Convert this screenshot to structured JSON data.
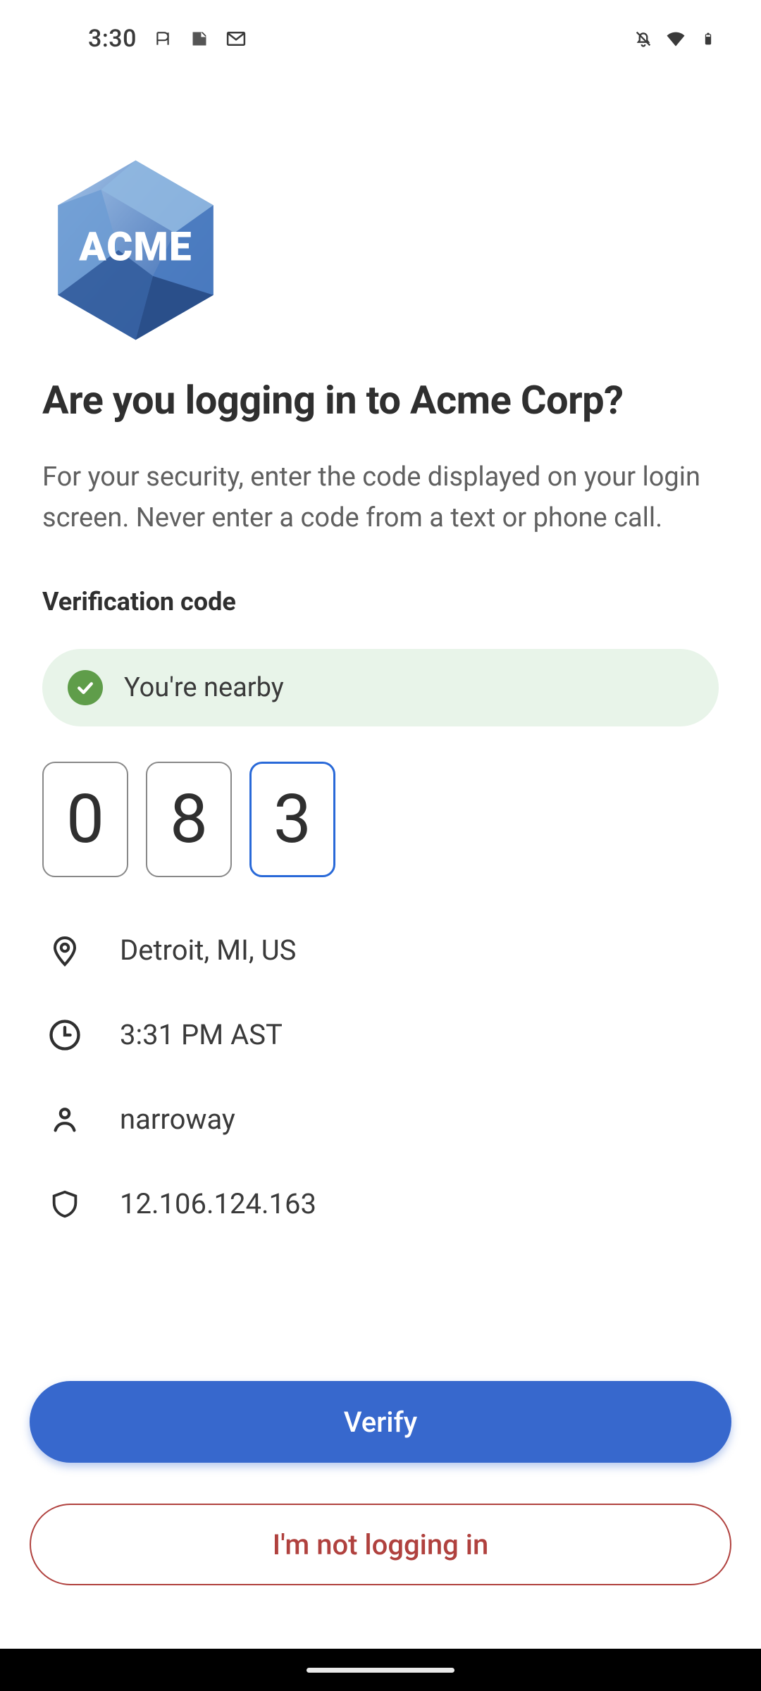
{
  "statusbar": {
    "time": "3:30"
  },
  "logo": {
    "text": "ACME"
  },
  "header": {
    "title": "Are you logging in to Acme Corp?",
    "subtitle": "For your security, enter the code displayed on your login screen. Never enter a code from a text or phone call."
  },
  "verification": {
    "label": "Verification code",
    "nearby_text": "You're nearby",
    "code": [
      "0",
      "8",
      "3"
    ]
  },
  "details": {
    "location": "Detroit, MI, US",
    "time": "3:31 PM AST",
    "user": "narroway",
    "ip": "12.106.124.163"
  },
  "buttons": {
    "verify": "Verify",
    "deny": "I'm not logging in"
  }
}
